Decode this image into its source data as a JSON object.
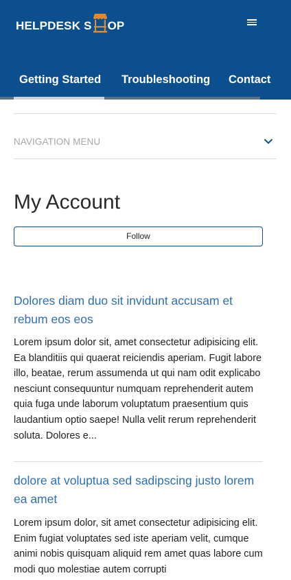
{
  "header": {
    "logo_text_left": "HELPDESK S",
    "logo_text_right": "OP",
    "colors": {
      "brand": "#0c4f8f",
      "accent": "#e08a2e",
      "link": "#2f6fae"
    },
    "menu_icon": "hamburger-icon"
  },
  "nav": {
    "tabs": [
      {
        "label": "Getting Started",
        "active": true
      },
      {
        "label": "Troubleshooting",
        "active": false
      },
      {
        "label": "Contact",
        "active": false
      }
    ]
  },
  "dropdown": {
    "label": "NAVIGATION MENU",
    "icon": "chevron-down-icon"
  },
  "page": {
    "title": "My Account",
    "follow_label": "Follow"
  },
  "articles": [
    {
      "title": "Dolores diam duo sit invidunt accusam et rebum eos eos",
      "excerpt": "Lorem ipsum dolor sit, amet consectetur adipisicing elit. Ea blanditiis qui quaerat reiciendis aperiam. Fugit labore illo, beatae, rerum assumenda ut qui nam odit explicabo nesciunt consequuntur numquam reprehenderit autem quia fuga unde laborum voluptatum praesentium quis laudantium optio saepe! Nulla velit rerum reprehenderit soluta. Dolores e..."
    },
    {
      "title": "dolore at voluptua sed sadipscing justo lorem ea amet",
      "excerpt": "Lorem ipsum dolor, sit amet consectetur adipisicing elit. Enim fugiat voluptates sed iste aperiam velit, cumque animi nobis quisquam aliquid rem amet quas labore cum modi quo molestiae autem corrupti"
    }
  ]
}
